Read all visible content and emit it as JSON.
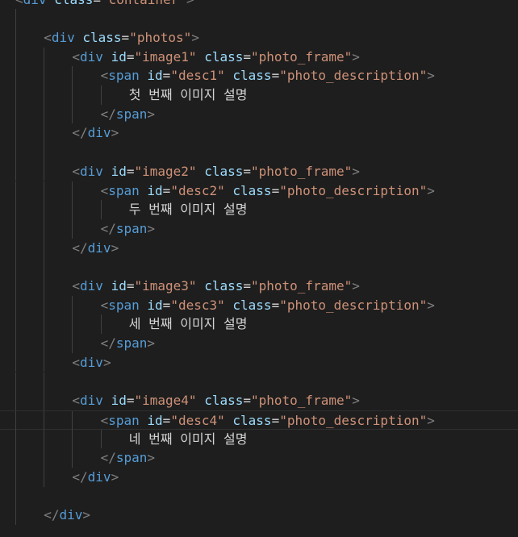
{
  "editor": {
    "language": "html",
    "current_line": 23,
    "colors": {
      "background": "#1e1e1e",
      "tag": "#569cd6",
      "punctuation": "#808080",
      "attribute": "#9cdcfe",
      "string": "#ce9178",
      "text": "#d4d4d4",
      "indent_guide": "#404040"
    },
    "lines": [
      {
        "indent": 0,
        "tokens": [
          [
            "p",
            "<"
          ],
          [
            "tag",
            "div"
          ],
          [
            "t",
            " "
          ],
          [
            "attr",
            "class"
          ],
          [
            "eq",
            "="
          ],
          [
            "str",
            "\"container\""
          ],
          [
            "p",
            ">"
          ]
        ]
      },
      {
        "indent": 0,
        "tokens": []
      },
      {
        "indent": 1,
        "tokens": [
          [
            "p",
            "<"
          ],
          [
            "tag",
            "div"
          ],
          [
            "t",
            " "
          ],
          [
            "attr",
            "class"
          ],
          [
            "eq",
            "="
          ],
          [
            "str",
            "\"photos\""
          ],
          [
            "p",
            ">"
          ]
        ]
      },
      {
        "indent": 2,
        "tokens": [
          [
            "p",
            "<"
          ],
          [
            "tag",
            "div"
          ],
          [
            "t",
            " "
          ],
          [
            "attr",
            "id"
          ],
          [
            "eq",
            "="
          ],
          [
            "str",
            "\"image1\""
          ],
          [
            "t",
            " "
          ],
          [
            "attr",
            "class"
          ],
          [
            "eq",
            "="
          ],
          [
            "str",
            "\"photo_frame\""
          ],
          [
            "p",
            ">"
          ]
        ]
      },
      {
        "indent": 3,
        "tokens": [
          [
            "p",
            "<"
          ],
          [
            "tag",
            "span"
          ],
          [
            "t",
            " "
          ],
          [
            "attr",
            "id"
          ],
          [
            "eq",
            "="
          ],
          [
            "str",
            "\"desc1\""
          ],
          [
            "t",
            " "
          ],
          [
            "attr",
            "class"
          ],
          [
            "eq",
            "="
          ],
          [
            "str",
            "\"photo_description\""
          ],
          [
            "p",
            ">"
          ]
        ]
      },
      {
        "indent": 4,
        "tokens": [
          [
            "t",
            "첫 번째 이미지 설명"
          ]
        ]
      },
      {
        "indent": 3,
        "tokens": [
          [
            "p",
            "</"
          ],
          [
            "tag",
            "span"
          ],
          [
            "p",
            ">"
          ]
        ]
      },
      {
        "indent": 2,
        "tokens": [
          [
            "p",
            "</"
          ],
          [
            "tag",
            "div"
          ],
          [
            "p",
            ">"
          ]
        ]
      },
      {
        "indent": 0,
        "tokens": []
      },
      {
        "indent": 2,
        "tokens": [
          [
            "p",
            "<"
          ],
          [
            "tag",
            "div"
          ],
          [
            "t",
            " "
          ],
          [
            "attr",
            "id"
          ],
          [
            "eq",
            "="
          ],
          [
            "str",
            "\"image2\""
          ],
          [
            "t",
            " "
          ],
          [
            "attr",
            "class"
          ],
          [
            "eq",
            "="
          ],
          [
            "str",
            "\"photo_frame\""
          ],
          [
            "p",
            ">"
          ]
        ]
      },
      {
        "indent": 3,
        "tokens": [
          [
            "p",
            "<"
          ],
          [
            "tag",
            "span"
          ],
          [
            "t",
            " "
          ],
          [
            "attr",
            "id"
          ],
          [
            "eq",
            "="
          ],
          [
            "str",
            "\"desc2\""
          ],
          [
            "t",
            " "
          ],
          [
            "attr",
            "class"
          ],
          [
            "eq",
            "="
          ],
          [
            "str",
            "\"photo_description\""
          ],
          [
            "p",
            ">"
          ]
        ]
      },
      {
        "indent": 4,
        "tokens": [
          [
            "t",
            "두 번째 이미지 설명"
          ]
        ]
      },
      {
        "indent": 3,
        "tokens": [
          [
            "p",
            "</"
          ],
          [
            "tag",
            "span"
          ],
          [
            "p",
            ">"
          ]
        ]
      },
      {
        "indent": 2,
        "tokens": [
          [
            "p",
            "</"
          ],
          [
            "tag",
            "div"
          ],
          [
            "p",
            ">"
          ]
        ]
      },
      {
        "indent": 0,
        "tokens": []
      },
      {
        "indent": 2,
        "tokens": [
          [
            "p",
            "<"
          ],
          [
            "tag",
            "div"
          ],
          [
            "t",
            " "
          ],
          [
            "attr",
            "id"
          ],
          [
            "eq",
            "="
          ],
          [
            "str",
            "\"image3\""
          ],
          [
            "t",
            " "
          ],
          [
            "attr",
            "class"
          ],
          [
            "eq",
            "="
          ],
          [
            "str",
            "\"photo_frame\""
          ],
          [
            "p",
            ">"
          ]
        ]
      },
      {
        "indent": 3,
        "tokens": [
          [
            "p",
            "<"
          ],
          [
            "tag",
            "span"
          ],
          [
            "t",
            " "
          ],
          [
            "attr",
            "id"
          ],
          [
            "eq",
            "="
          ],
          [
            "str",
            "\"desc3\""
          ],
          [
            "t",
            " "
          ],
          [
            "attr",
            "class"
          ],
          [
            "eq",
            "="
          ],
          [
            "str",
            "\"photo_description\""
          ],
          [
            "p",
            ">"
          ]
        ]
      },
      {
        "indent": 4,
        "tokens": [
          [
            "t",
            "세 번째 이미지 설명"
          ]
        ]
      },
      {
        "indent": 3,
        "tokens": [
          [
            "p",
            "</"
          ],
          [
            "tag",
            "span"
          ],
          [
            "p",
            ">"
          ]
        ]
      },
      {
        "indent": 2,
        "tokens": [
          [
            "p",
            "<"
          ],
          [
            "tag",
            "div"
          ],
          [
            "p",
            ">"
          ]
        ]
      },
      {
        "indent": 0,
        "tokens": []
      },
      {
        "indent": 2,
        "tokens": [
          [
            "p",
            "<"
          ],
          [
            "tag",
            "div"
          ],
          [
            "t",
            " "
          ],
          [
            "attr",
            "id"
          ],
          [
            "eq",
            "="
          ],
          [
            "str",
            "\"image4\""
          ],
          [
            "t",
            " "
          ],
          [
            "attr",
            "class"
          ],
          [
            "eq",
            "="
          ],
          [
            "str",
            "\"photo_frame\""
          ],
          [
            "p",
            ">"
          ]
        ]
      },
      {
        "indent": 3,
        "tokens": [
          [
            "p",
            "<"
          ],
          [
            "tag",
            "span"
          ],
          [
            "t",
            " "
          ],
          [
            "attr",
            "id"
          ],
          [
            "eq",
            "="
          ],
          [
            "str",
            "\"desc4\""
          ],
          [
            "t",
            " "
          ],
          [
            "attr",
            "class"
          ],
          [
            "eq",
            "="
          ],
          [
            "str",
            "\"photo_description\""
          ],
          [
            "p",
            ">"
          ]
        ]
      },
      {
        "indent": 4,
        "tokens": [
          [
            "t",
            "네 번째 이미지 설명"
          ]
        ]
      },
      {
        "indent": 3,
        "tokens": [
          [
            "p",
            "</"
          ],
          [
            "tag",
            "span"
          ],
          [
            "p",
            ">"
          ]
        ]
      },
      {
        "indent": 2,
        "tokens": [
          [
            "p",
            "</"
          ],
          [
            "tag",
            "div"
          ],
          [
            "p",
            ">"
          ]
        ]
      },
      {
        "indent": 0,
        "tokens": []
      },
      {
        "indent": 1,
        "tokens": [
          [
            "p",
            "</"
          ],
          [
            "tag",
            "div"
          ],
          [
            "p",
            ">"
          ]
        ]
      }
    ]
  }
}
